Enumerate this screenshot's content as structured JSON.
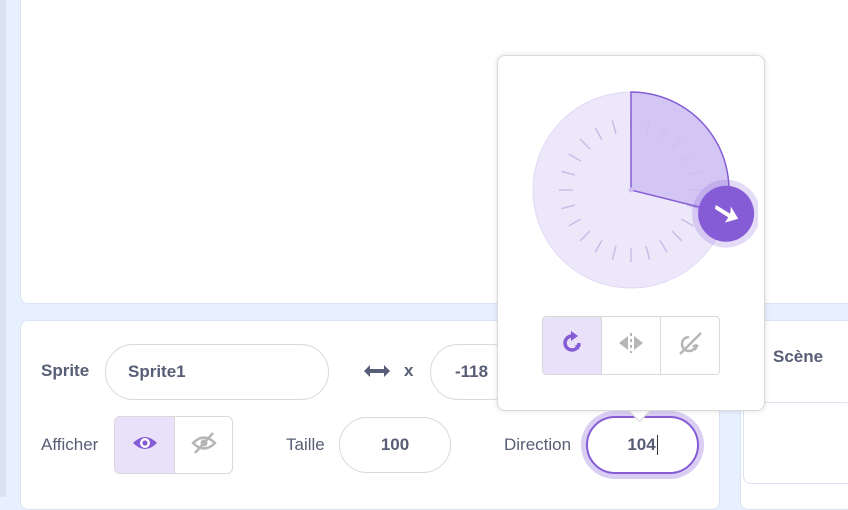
{
  "sprite": {
    "label": "Sprite",
    "name_value": "Sprite1",
    "x_label": "x",
    "x_value": "-118"
  },
  "show": {
    "label": "Afficher",
    "visible_selected": true
  },
  "size": {
    "label": "Taille",
    "value": "100"
  },
  "direction": {
    "label": "Direction",
    "value": "104",
    "dial_degrees": 104,
    "rotation_styles": [
      {
        "name": "all-around",
        "icon": "rotate-icon",
        "selected": true
      },
      {
        "name": "left-right",
        "icon": "flip-horizontal-icon",
        "selected": false
      },
      {
        "name": "dont-rotate",
        "icon": "no-rotate-icon",
        "selected": false
      }
    ]
  },
  "stage": {
    "label": "Scène"
  },
  "colors": {
    "accent": "#855cd6",
    "accent_light": "#cfbff2",
    "dial_bg": "#ede7fa",
    "text": "#575e75",
    "border": "#d9d9d9"
  },
  "icons": [
    "arrows-horizontal-icon",
    "eye-icon",
    "eye-slash-icon",
    "rotate-icon",
    "flip-horizontal-icon",
    "no-rotate-icon",
    "direction-arrow-icon"
  ]
}
